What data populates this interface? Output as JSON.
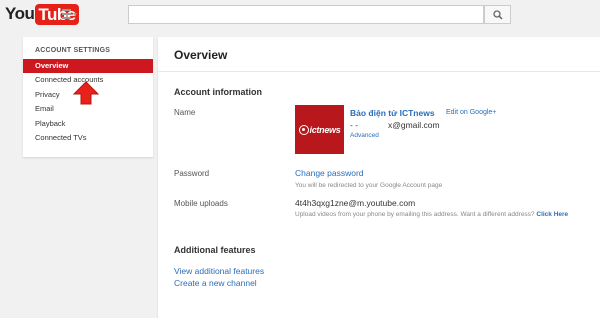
{
  "header": {
    "logo_you": "You",
    "logo_tube": "Tube",
    "search_placeholder": ""
  },
  "sidebar": {
    "heading": "ACCOUNT SETTINGS",
    "items": [
      {
        "label": "Overview",
        "active": true
      },
      {
        "label": "Connected accounts",
        "active": false
      },
      {
        "label": "Privacy",
        "active": false
      },
      {
        "label": "Email",
        "active": false
      },
      {
        "label": "Playback",
        "active": false
      },
      {
        "label": "Connected TVs",
        "active": false
      }
    ]
  },
  "main": {
    "title": "Overview",
    "account_info": {
      "heading": "Account information",
      "name_label": "Name",
      "avatar_text": "ictnews",
      "channel_name": "Bảo điện tử ICTnews",
      "edit_link": "Edit on Google+",
      "email_masked": "-  -",
      "email": "x@gmail.com",
      "advanced_link": "Advanced",
      "password_label": "Password",
      "change_password": "Change password",
      "password_help": "You will be redirected to your Google Account page",
      "mobile_label": "Mobile uploads",
      "mobile_email": "4t4h3qxg1zne@m.youtube.com",
      "mobile_help": "Upload videos from your phone by emailing this address. Want a different address?",
      "click_here": "Click Here"
    },
    "additional": {
      "heading": "Additional features",
      "view_link": "View additional features",
      "create_link": "Create a new channel"
    }
  },
  "colors": {
    "accent_red": "#cc181e",
    "link_blue": "#2a6ebb"
  }
}
